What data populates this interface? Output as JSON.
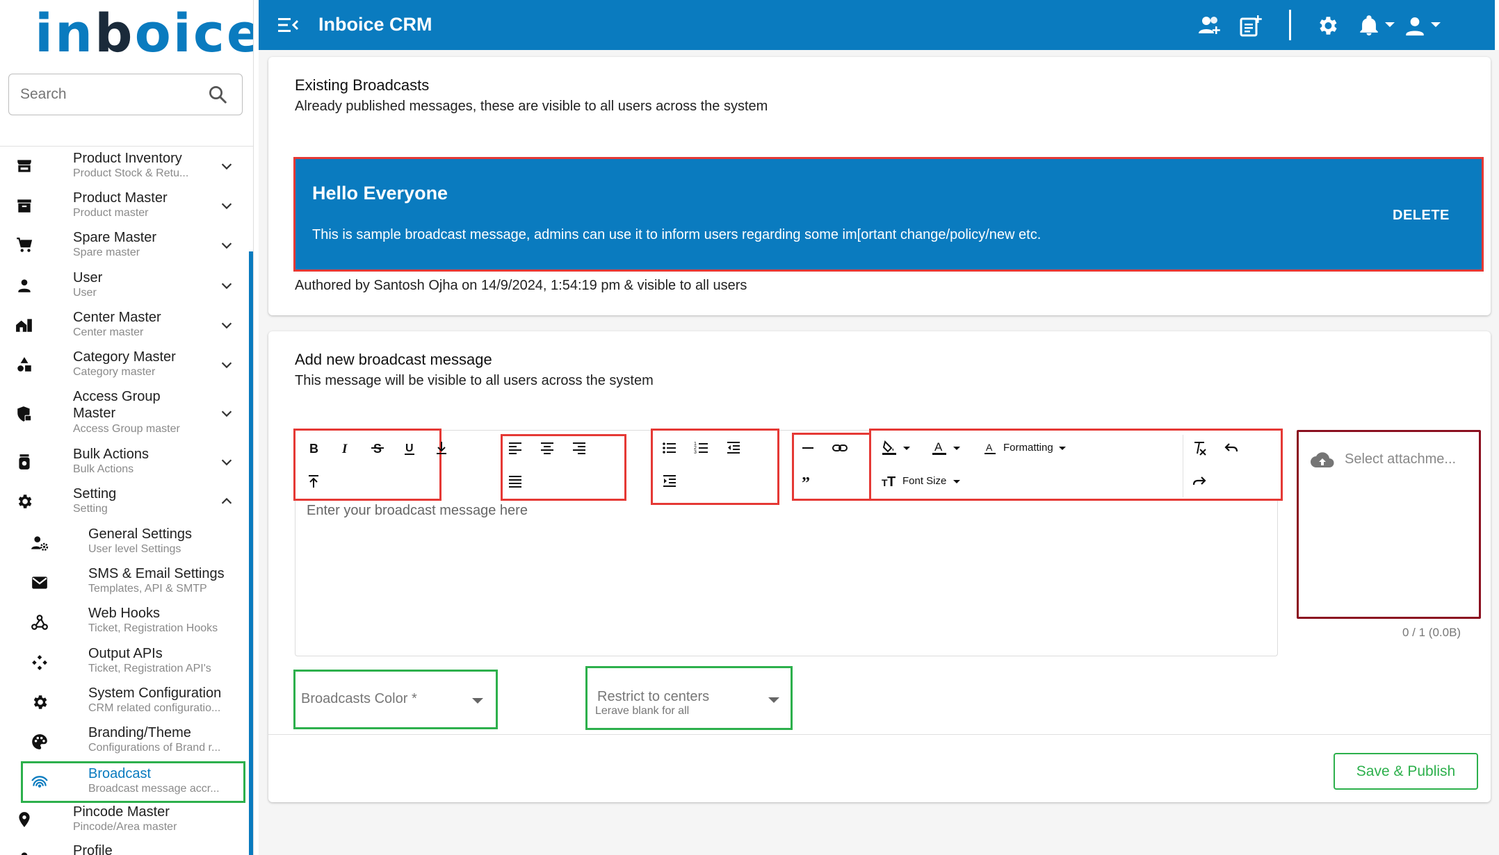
{
  "app": {
    "logo_text": "inboice",
    "title": "Inboice CRM"
  },
  "search": {
    "placeholder": "Search"
  },
  "sidebar": {
    "items": [
      {
        "name": "product-inventory",
        "icon": "store-icon",
        "title": "Product Inventory",
        "subtitle": "Product Stock & Retu...",
        "chevron": "down"
      },
      {
        "name": "product-master",
        "icon": "archive-icon",
        "title": "Product Master",
        "subtitle": "Product master",
        "chevron": "down"
      },
      {
        "name": "spare-master",
        "icon": "cart-icon",
        "title": "Spare Master",
        "subtitle": "Spare master",
        "chevron": "down"
      },
      {
        "name": "user",
        "icon": "person-icon",
        "title": "User",
        "subtitle": "User",
        "chevron": "down"
      },
      {
        "name": "center-master",
        "icon": "home-work-icon",
        "title": "Center Master",
        "subtitle": "Center master",
        "chevron": "down"
      },
      {
        "name": "category-master",
        "icon": "category-shapes-icon",
        "title": "Category Master",
        "subtitle": "Category master",
        "chevron": "down"
      },
      {
        "name": "access-group-master",
        "icon": "shield-lock-icon",
        "title": "Access Group Master",
        "subtitle": "Access Group master",
        "chevron": "down"
      },
      {
        "name": "bulk-actions",
        "icon": "bulk-actions-icon",
        "title": "Bulk Actions",
        "subtitle": "Bulk Actions",
        "chevron": "down"
      },
      {
        "name": "setting",
        "icon": "gear-icon",
        "title": "Setting",
        "subtitle": "Setting",
        "chevron": "up"
      }
    ],
    "sub_items": [
      {
        "name": "general-settings",
        "icon": "user-settings-icon",
        "title": "General Settings",
        "subtitle": "User level Settings"
      },
      {
        "name": "sms-email-settings",
        "icon": "mail-icon",
        "title": "SMS & Email Settings",
        "subtitle": "Templates, API & SMTP"
      },
      {
        "name": "web-hooks",
        "icon": "webhook-icon",
        "title": "Web Hooks",
        "subtitle": "Ticket, Registration Hooks"
      },
      {
        "name": "output-apis",
        "icon": "api-icon",
        "title": "Output APIs",
        "subtitle": "Ticket, Registration API's"
      },
      {
        "name": "system-configuration",
        "icon": "gear-icon",
        "title": "System Configuration",
        "subtitle": "CRM related configuratio..."
      },
      {
        "name": "branding-theme",
        "icon": "palette-icon",
        "title": "Branding/Theme",
        "subtitle": "Configurations of Brand r..."
      },
      {
        "name": "broadcast",
        "icon": "broadcast-icon",
        "title": "Broadcast",
        "subtitle": "Broadcast message accr...",
        "active": true
      }
    ],
    "after_items": [
      {
        "name": "pincode-master",
        "icon": "location-pin-icon",
        "title": "Pincode Master",
        "subtitle": "Pincode/Area master"
      },
      {
        "name": "profile",
        "icon": "profile-icon",
        "title": "Profile",
        "subtitle": ""
      }
    ]
  },
  "topbar": {
    "icons": [
      "menu-open-icon",
      "add-user-icon",
      "post-add-icon",
      "gear-icon",
      "bell-icon",
      "account-icon"
    ]
  },
  "existing": {
    "title": "Existing Broadcasts",
    "subtitle": "Already published messages, these are visible to all users across the system",
    "broadcast": {
      "title": "Hello Everyone",
      "body": "This is sample broadcast message, admins can use it to inform users regarding some im[ortant change/policy/new etc.",
      "delete_label": "DELETE",
      "color": "#0a7bbf",
      "author_line": "Authored by Santosh Ojha on 14/9/2024, 1:54:19 pm & visible to all users"
    }
  },
  "new_message": {
    "title": "Add new broadcast message",
    "subtitle": "This message will be visible to all users across the system",
    "editor": {
      "placeholder": "Enter your broadcast message here",
      "toolbar": {
        "formatting_label": "Formatting",
        "font_size_label": "Font Size",
        "buttons": [
          "bold",
          "italic",
          "strikethrough",
          "underline",
          "subscript",
          "superscript",
          "align-left",
          "align-center",
          "align-right",
          "align-justify",
          "bullet-list",
          "numbered-list",
          "outdent",
          "indent",
          "horizontal-rule",
          "link",
          "quote",
          "highlight-color",
          "text-color",
          "clear-formatting",
          "undo",
          "redo"
        ]
      }
    },
    "attachment": {
      "label": "Select attachme...",
      "count": "0 / 1 (0.0B)"
    },
    "color_select": {
      "label": "Broadcasts Color *"
    },
    "centers_select": {
      "label": "Restrict to centers",
      "hint": "Lerave blank for all"
    },
    "save_label": "Save & Publish"
  },
  "colors": {
    "primary": "#0a7bbf",
    "highlight_red": "#e53935",
    "highlight_green": "#2db04c",
    "attachment_border": "#8b1020"
  }
}
